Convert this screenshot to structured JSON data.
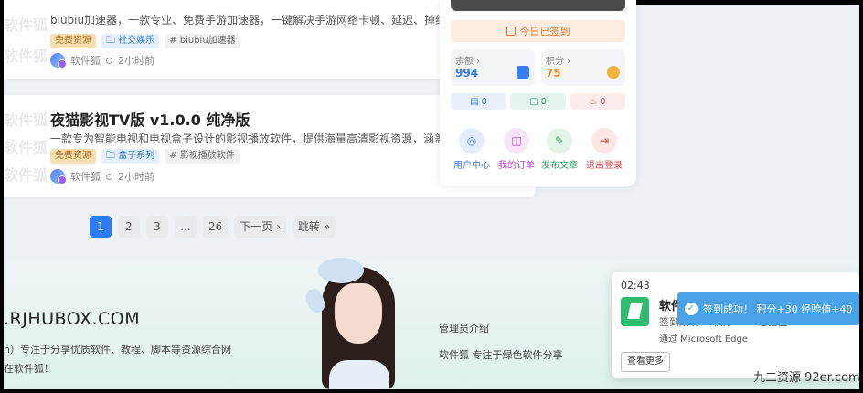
{
  "articles": [
    {
      "title": "",
      "desc": "biubiu加速器，一款专业、免费手游加速器，一键解决手游网络卡顿、延迟、掉线、加",
      "tags": [
        "免费资源",
        "社交娱乐",
        "# biubiu加速器"
      ],
      "author": "软件狐",
      "time": "2小时前"
    },
    {
      "title": "夜猫影视TV版 v1.0.0 纯净版",
      "desc": "一款专为智能电视和电视盒子设计的影视播放软件，提供海量高清影视资源，涵盖电影",
      "tags": [
        "免费资源",
        "盒子系列",
        "# 影视播放软件"
      ],
      "author": "软件狐",
      "time": "2小时前"
    }
  ],
  "watermark_text": "软件狐",
  "pagination": {
    "pages": [
      "1",
      "2",
      "3",
      "...",
      "26"
    ],
    "next": "下一页 ›",
    "jump": "跳转 »",
    "active": "1"
  },
  "user_panel": {
    "signed_label": "今日已签到",
    "balance_label": "余额 ›",
    "balance_value": "994",
    "points_label": "积分 ›",
    "points_value": "75",
    "counts": [
      "0",
      "0",
      "0"
    ],
    "actions": [
      "用户中心",
      "我的订单",
      "发布文章",
      "退出登录"
    ]
  },
  "footer": {
    "site_url": ".RJHUBOX.COM",
    "intro_line1": "n）专注于分享优质软件、教程、脚本等资源综合网",
    "intro_line2": "在软件狐！",
    "admin_title": "管理员介绍",
    "admin_desc": "软件狐 专注于绿色软件分享"
  },
  "notification": {
    "time": "02:43",
    "app": "软件狐",
    "message": "签到成功！ 积分+30 经验值+40",
    "via": "通过 Microsoft Edge",
    "more_button": "查看更多"
  },
  "toast": {
    "message": "签到成功！ 积分+30 经验值+40"
  },
  "corner_watermark": "九二资源 92er.com",
  "colors": {
    "accent": "#2d7cf6",
    "signed": "#e2762c",
    "balance": "#2d7cf6",
    "points": "#e8901c",
    "toast": "#4aa2e8"
  }
}
